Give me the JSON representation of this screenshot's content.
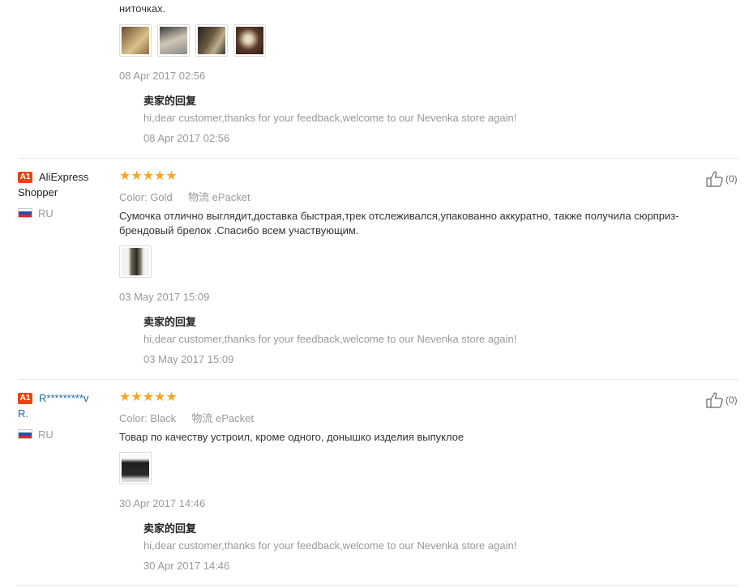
{
  "review0": {
    "text_tail": "ниточках.",
    "date": "08 Apr 2017 02:56",
    "reply": {
      "title": "卖家的回复",
      "text": "hi,dear customer,thanks for your feedback,welcome to our Nevenka store again!",
      "date": "08 Apr 2017 02:56"
    }
  },
  "review1": {
    "badge": "A1",
    "name_line1": "AliExpress",
    "name_line2": "Shopper",
    "country": "RU",
    "stars": "★★★★★",
    "color_label": "Color:",
    "color_value": "Gold",
    "ship_label": "物流",
    "ship_value": "ePacket",
    "text_line1": "Сумочка отлично выглядит,доставка быстрая,трек отслеживался,упакованно аккуратно, также получила сюрприз-",
    "text_line2": "брендовый брелок .Спасибо всем участвующим.",
    "date": "03 May 2017 15:09",
    "likes": "(0)",
    "reply": {
      "title": "卖家的回复",
      "text": "hi,dear customer,thanks for your feedback,welcome to our Nevenka store again!",
      "date": "03 May 2017 15:09"
    }
  },
  "review2": {
    "badge": "A1",
    "name_line1": "R*********v",
    "name_line2": "R.",
    "country": "RU",
    "stars": "★★★★★",
    "color_label": "Color:",
    "color_value": "Black",
    "ship_label": "物流",
    "ship_value": "ePacket",
    "text_line1": "Товар по качеству устроил, кроме одного, донышко изделия выпуклое",
    "date": "30 Apr 2017 14:46",
    "likes": "(0)",
    "reply": {
      "title": "卖家的回复",
      "text": "hi,dear customer,thanks for your feedback,welcome to our Nevenka store again!",
      "date": "30 Apr 2017 14:46"
    }
  },
  "colors": {
    "star": "#f5a623",
    "badge": "#e8440f",
    "link": "#1a66b3"
  },
  "icons": {
    "like": "thumbs-up-icon",
    "flag": "russia-flag-icon"
  }
}
